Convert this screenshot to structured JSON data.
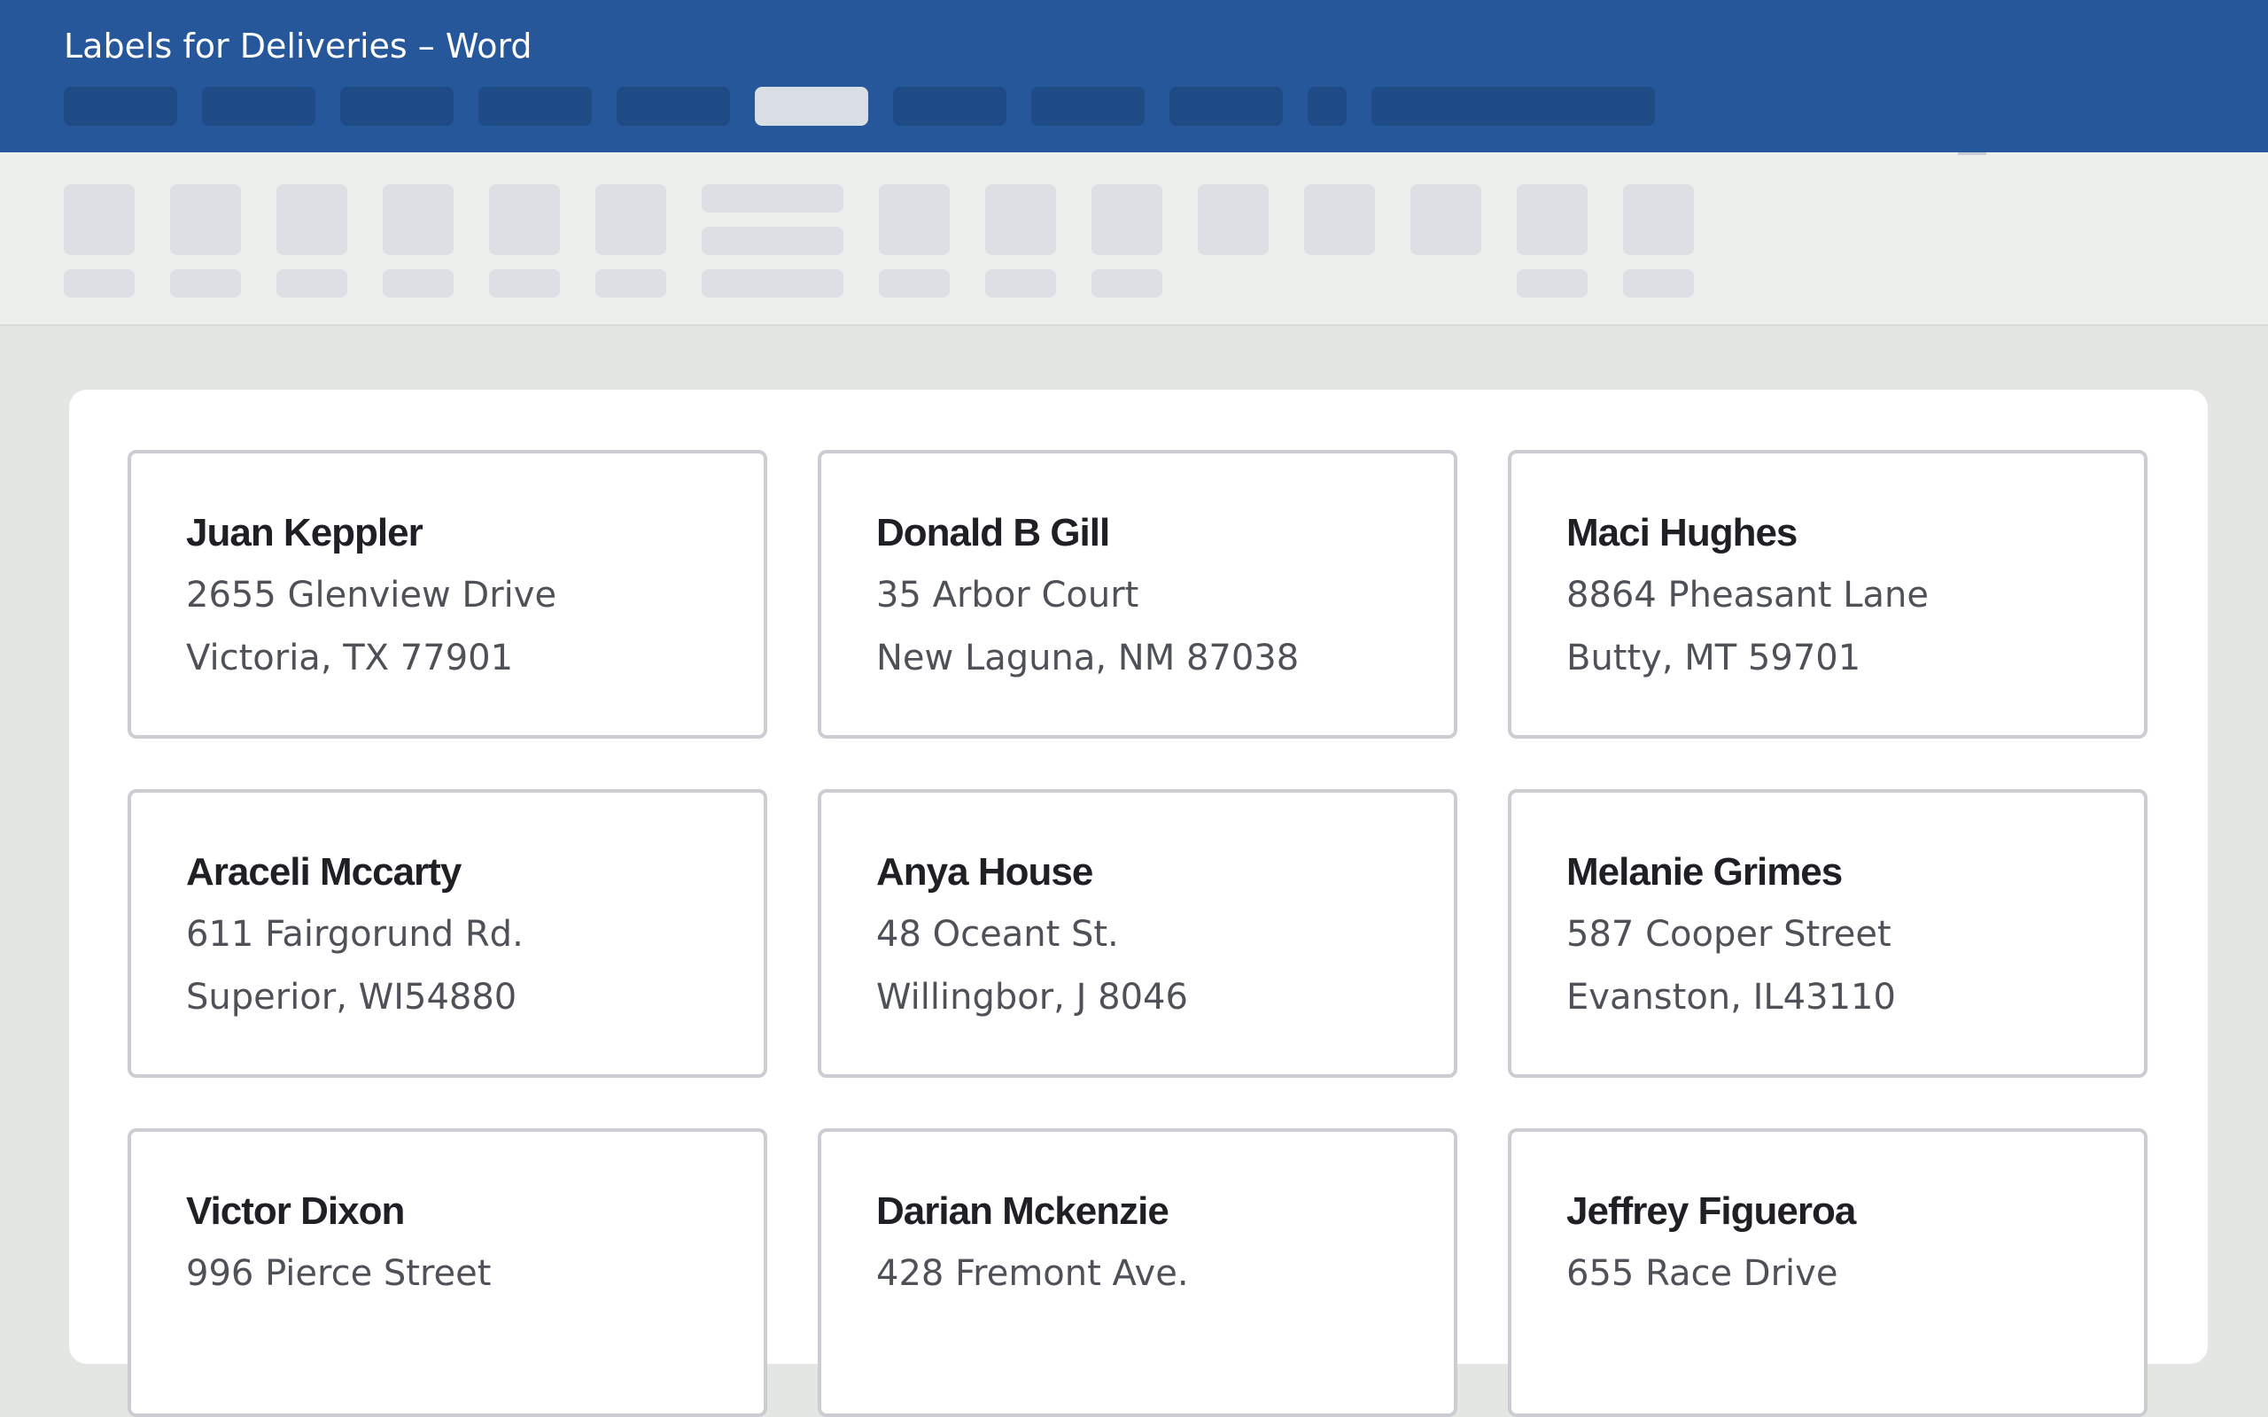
{
  "app": {
    "title": "Labels for Deliveries – Word"
  },
  "ribbon": {
    "active_tab_index": 5
  },
  "labels": [
    {
      "name": "Juan Keppler",
      "line1": "2655 Glenview Drive",
      "line2": "Victoria, TX 77901"
    },
    {
      "name": "Donald B Gill",
      "line1": "35 Arbor Court",
      "line2": "New Laguna, NM 87038"
    },
    {
      "name": "Maci Hughes",
      "line1": "8864 Pheasant Lane",
      "line2": "Butty, MT 59701"
    },
    {
      "name": "Araceli Mccarty",
      "line1": "611 Fairgorund Rd.",
      "line2": "Superior, WI54880"
    },
    {
      "name": "Anya House",
      "line1": "48 Oceant St.",
      "line2": "Willingbor, J 8046"
    },
    {
      "name": "Melanie Grimes",
      "line1": "587 Cooper Street",
      "line2": "Evanston, IL43110"
    },
    {
      "name": "Victor Dixon",
      "line1": "996 Pierce Street",
      "line2": ""
    },
    {
      "name": "Darian Mckenzie",
      "line1": "428 Fremont Ave.",
      "line2": ""
    },
    {
      "name": "Jeffrey Figueroa",
      "line1": "655 Race Drive",
      "line2": ""
    }
  ]
}
